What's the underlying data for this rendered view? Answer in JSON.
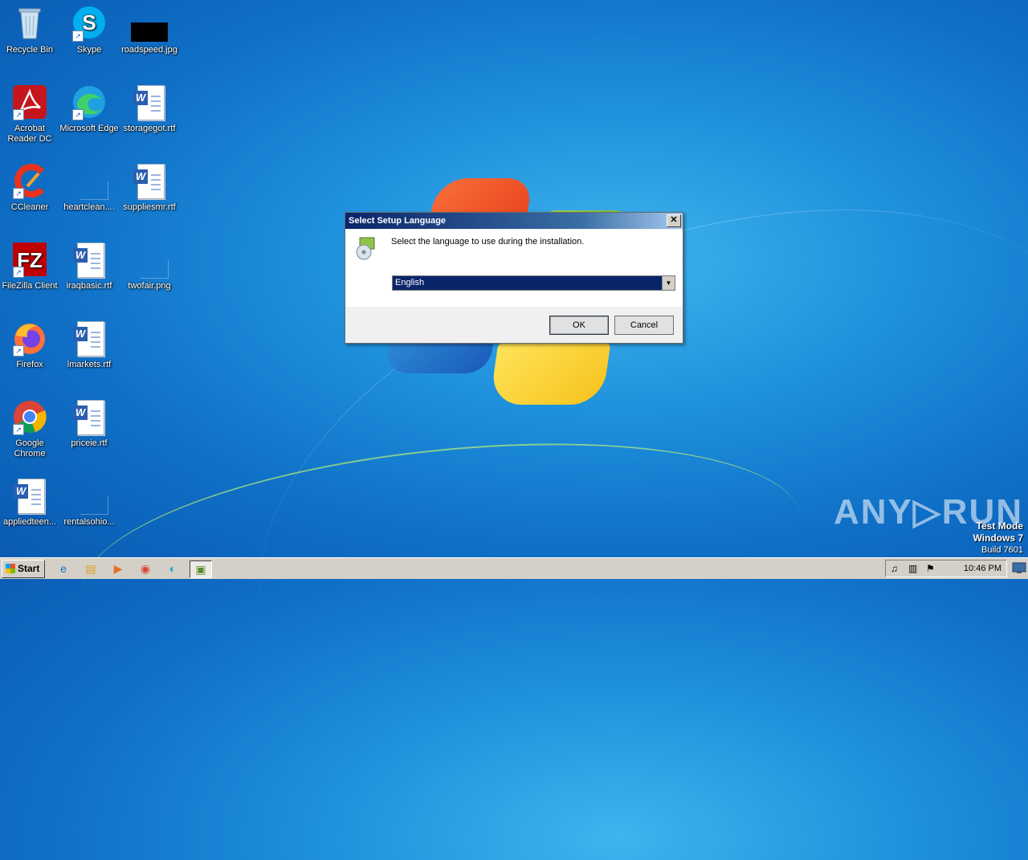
{
  "desktop": {
    "icons": [
      {
        "label": "Recycle Bin"
      },
      {
        "label": "Skype"
      },
      {
        "label": "roadspeed.jpg"
      },
      {
        "label": "Acrobat Reader DC"
      },
      {
        "label": "Microsoft Edge"
      },
      {
        "label": "storagegot.rtf"
      },
      {
        "label": "CCleaner"
      },
      {
        "label": "heartclean...."
      },
      {
        "label": "suppliesmr.rtf"
      },
      {
        "label": "FileZilla Client"
      },
      {
        "label": "iraqbasic.rtf"
      },
      {
        "label": "twofair.png"
      },
      {
        "label": "Firefox"
      },
      {
        "label": "lmarkets.rtf"
      },
      {
        "label": "Google Chrome"
      },
      {
        "label": "priceie.rtf"
      },
      {
        "label": "appliedteen..."
      },
      {
        "label": "rentalsohio..."
      }
    ]
  },
  "dialog": {
    "title": "Select Setup Language",
    "close_glyph": "✕",
    "prompt": "Select the language to use during the installation.",
    "language_selected": "English",
    "ok_label": "OK",
    "cancel_label": "Cancel"
  },
  "watermark": {
    "brand": "ANY▷RUN",
    "test_mode": "Test Mode",
    "os": "Windows 7",
    "build": "Build 7601"
  },
  "taskbar": {
    "start_label": "Start",
    "clock": "10:46 PM"
  },
  "colors": {
    "title_start": "#0a246a",
    "selection": "#0a246a",
    "taskbar": "#d4d0c8"
  }
}
